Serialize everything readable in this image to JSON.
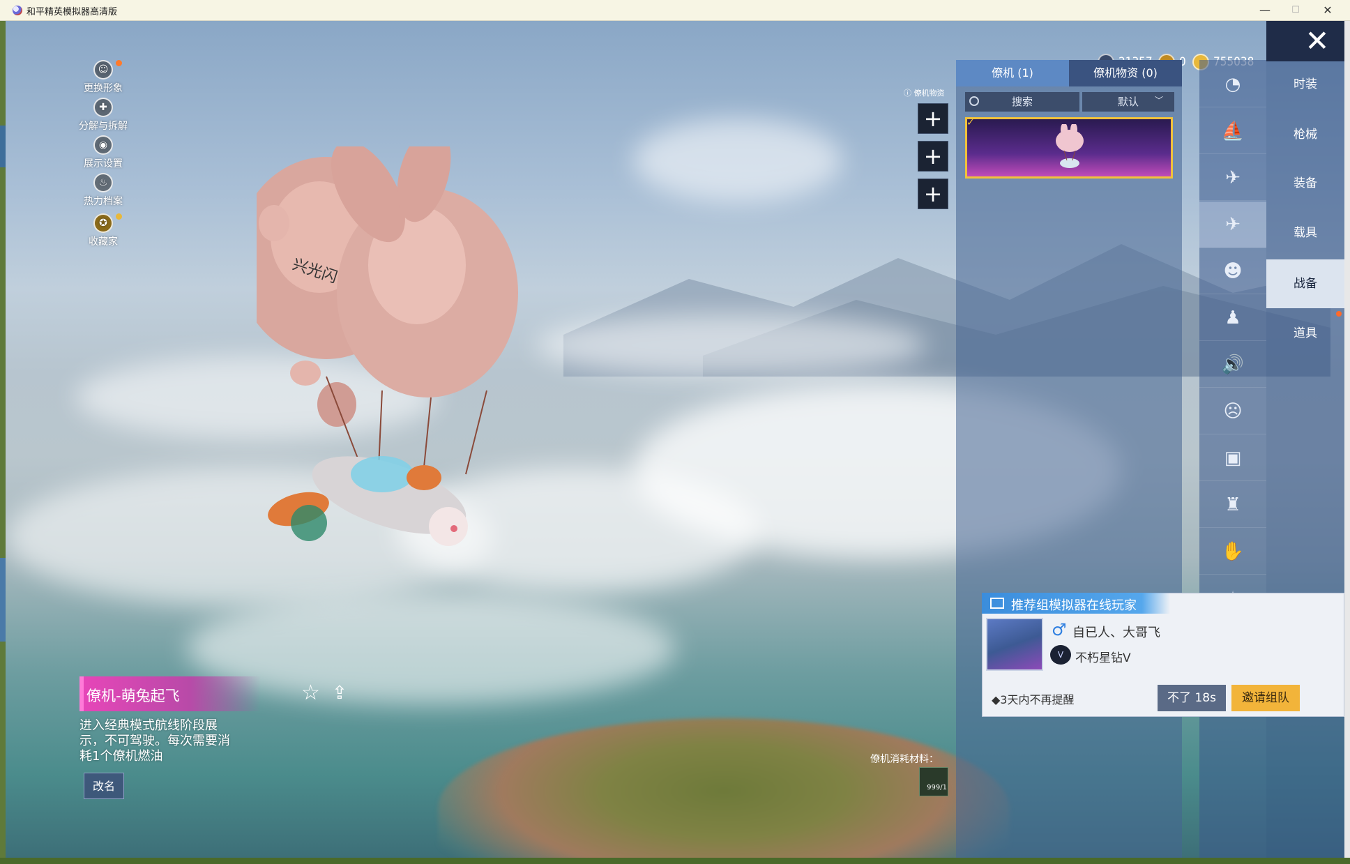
{
  "window": {
    "title": "和平精英模拟器高清版",
    "minimize": "—",
    "maximize": "☐",
    "close": "✕"
  },
  "currency": [
    {
      "icon": "silver-coin-icon",
      "value": "21357"
    },
    {
      "icon": "gold-token-icon",
      "value": "0"
    },
    {
      "icon": "gold-coin-icon",
      "value": "755038"
    }
  ],
  "close_button": "✕",
  "left_menu": [
    {
      "label": "更换形象",
      "icon": "character-icon",
      "glyph": "☺"
    },
    {
      "label": "分解与拆解",
      "icon": "dismantle-icon",
      "glyph": "✚"
    },
    {
      "label": "展示设置",
      "icon": "eye-icon",
      "glyph": "◉"
    },
    {
      "label": "热力档案",
      "icon": "flame-icon",
      "glyph": "♨"
    },
    {
      "label": "收藏家",
      "icon": "collector-icon",
      "glyph": "✪"
    }
  ],
  "slot_hint": "ⓘ 僚机物资",
  "plus_button": "+",
  "item_panel": {
    "tabs": [
      "僚机 (1)",
      "僚机物资 (0)"
    ],
    "search_placeholder": "搜索",
    "sort": "默认",
    "sort_chevron": "﹀",
    "check": "✓"
  },
  "category_icons": [
    {
      "icon": "outfit-icon",
      "glyph": "◔"
    },
    {
      "icon": "vehicle-boat-icon",
      "glyph": "⛵"
    },
    {
      "icon": "plane-icon",
      "glyph": "✈"
    },
    {
      "icon": "parachute-plane-icon",
      "glyph": "✈",
      "selected": true
    },
    {
      "icon": "face-icon",
      "glyph": "☻"
    },
    {
      "icon": "pet-icon",
      "glyph": "♟"
    },
    {
      "icon": "sound-icon",
      "glyph": "🔊"
    },
    {
      "icon": "emote-icon",
      "glyph": "☹"
    },
    {
      "icon": "image-icon",
      "glyph": "▣"
    },
    {
      "icon": "spray-icon",
      "glyph": "♜"
    },
    {
      "icon": "gesture-icon",
      "glyph": "✋"
    },
    {
      "icon": "fx-icon",
      "glyph": "✦"
    },
    {
      "icon": "misc-icon",
      "glyph": "☄"
    }
  ],
  "nav": [
    "时装",
    "枪械",
    "装备",
    "载具",
    "战备",
    "道具"
  ],
  "item": {
    "name": "僚机-萌兔起飞",
    "description": "进入经典模式航线阶段展示，不可驾驶。每次需要消耗1个僚机燃油",
    "rename": "改名",
    "star": "☆",
    "share": "⇪",
    "consume_label": "僚机消耗材料：",
    "consume_count": "999/1"
  },
  "invite": {
    "title": "推荐组模拟器在线玩家",
    "gender": "♂",
    "player_name": "自已人、大哥飞",
    "rank_badge": "V",
    "rank": "不朽星钻Ⅴ",
    "remind": "◆3天内不再提醒",
    "decline": "不了 18s",
    "accept": "邀请组队"
  },
  "colors": {
    "accent_pink": "#e646b8",
    "card_border": "#f1c23c",
    "invite_button": "#f2b43a",
    "tab_active": "#5d89c4"
  }
}
